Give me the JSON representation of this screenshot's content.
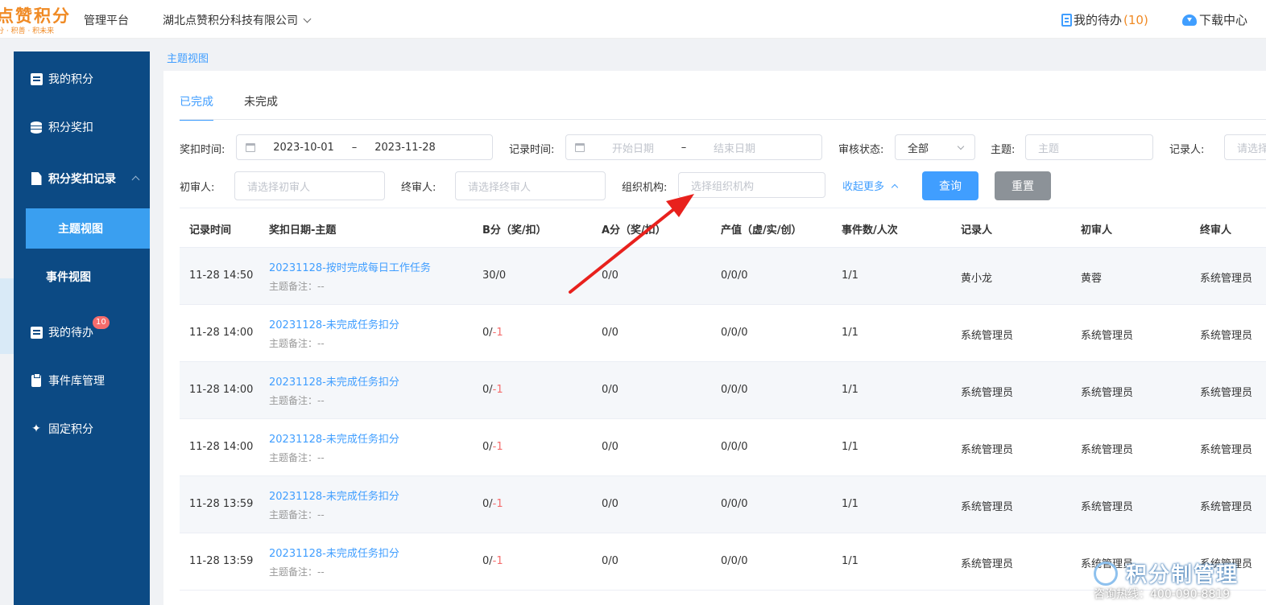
{
  "header": {
    "logo_text": "点赞积分",
    "logo_slogan": "分 · 积善 · 积未来",
    "platform": "管理平台",
    "company": "湖北点赞积分科技有限公司",
    "todo_label": "我的待办",
    "todo_count": "(10)",
    "download_label": "下载中心"
  },
  "sidebar": {
    "items": [
      {
        "label": "我的积分",
        "icon": "score-card-icon"
      },
      {
        "label": "积分奖扣",
        "icon": "database-icon"
      },
      {
        "label": "积分奖扣记录",
        "icon": "file-icon"
      },
      {
        "label": "主题视图"
      },
      {
        "label": "事件视图"
      },
      {
        "label": "我的待办",
        "icon": "todo-icon",
        "badge": "10"
      },
      {
        "label": "事件库管理",
        "icon": "clipboard-icon"
      },
      {
        "label": "固定积分",
        "icon": "pin-icon"
      }
    ]
  },
  "breadcrumb": "主题视图",
  "tabs": [
    "已完成",
    "未完成"
  ],
  "filters": {
    "reward_time_label": "奖扣时间:",
    "reward_start": "2023-10-01",
    "reward_end": "2023-11-28",
    "range_sep": "–",
    "record_time_label": "记录时间:",
    "record_start_ph": "开始日期",
    "record_end_ph": "结束日期",
    "audit_status_label": "审核状态:",
    "audit_status_value": "全部",
    "topic_label": "主题:",
    "topic_ph": "主题",
    "recorder_label": "记录人:",
    "recorder_ph": "请选择",
    "first_reviewer_label": "初审人:",
    "first_reviewer_ph": "请选择初审人",
    "final_reviewer_label": "终审人:",
    "final_reviewer_ph": "请选择终审人",
    "org_label": "组织机构:",
    "org_ph": "选择组织机构",
    "collapse_more": "收起更多",
    "query_btn": "查询",
    "reset_btn": "重置"
  },
  "table": {
    "headers": [
      "记录时间",
      "奖扣日期-主题",
      "B分（奖/扣）",
      "A分（奖/扣）",
      "产值（虚/实/创）",
      "事件数/人次",
      "记录人",
      "初审人",
      "终审人"
    ],
    "note_label": "主题备注：--",
    "rows": [
      {
        "time": "11-28 14:50",
        "topic": "20231128-按时完成每日工作任务",
        "b_pos": "30/",
        "b_neg": "0",
        "b_neg_red": false,
        "a": "0/0",
        "value": "0/0/0",
        "events": "1/1",
        "recorder": "黄小龙",
        "first": "黄蓉",
        "final": "系统管理员"
      },
      {
        "time": "11-28 14:00",
        "topic": "20231128-未完成任务扣分",
        "b_pos": "0/",
        "b_neg": "-1",
        "b_neg_red": true,
        "a": "0/0",
        "value": "0/0/0",
        "events": "1/1",
        "recorder": "系统管理员",
        "first": "系统管理员",
        "final": "系统管理员"
      },
      {
        "time": "11-28 14:00",
        "topic": "20231128-未完成任务扣分",
        "b_pos": "0/",
        "b_neg": "-1",
        "b_neg_red": true,
        "a": "0/0",
        "value": "0/0/0",
        "events": "1/1",
        "recorder": "系统管理员",
        "first": "系统管理员",
        "final": "系统管理员"
      },
      {
        "time": "11-28 14:00",
        "topic": "20231128-未完成任务扣分",
        "b_pos": "0/",
        "b_neg": "-1",
        "b_neg_red": true,
        "a": "0/0",
        "value": "0/0/0",
        "events": "1/1",
        "recorder": "系统管理员",
        "first": "系统管理员",
        "final": "系统管理员"
      },
      {
        "time": "11-28 13:59",
        "topic": "20231128-未完成任务扣分",
        "b_pos": "0/",
        "b_neg": "-1",
        "b_neg_red": true,
        "a": "0/0",
        "value": "0/0/0",
        "events": "1/1",
        "recorder": "系统管理员",
        "first": "系统管理员",
        "final": "系统管理员"
      },
      {
        "time": "11-28 13:59",
        "topic": "20231128-未完成任务扣分",
        "b_pos": "0/",
        "b_neg": "-1",
        "b_neg_red": true,
        "a": "0/0",
        "value": "0/0/0",
        "events": "1/1",
        "recorder": "系统管理员",
        "first": "系统管理员",
        "final": "系统管理员"
      }
    ]
  },
  "watermark": {
    "title": "积分制管理",
    "hotline": "咨询热线：400-090-8819"
  },
  "colors": {
    "primary": "#409eff",
    "sidebar_bg": "#0c4a84",
    "sidebar_active": "#3a9ff0",
    "brand_orange": "#f08a24",
    "negative": "#f56c6c",
    "arrow": "#e8211d"
  }
}
